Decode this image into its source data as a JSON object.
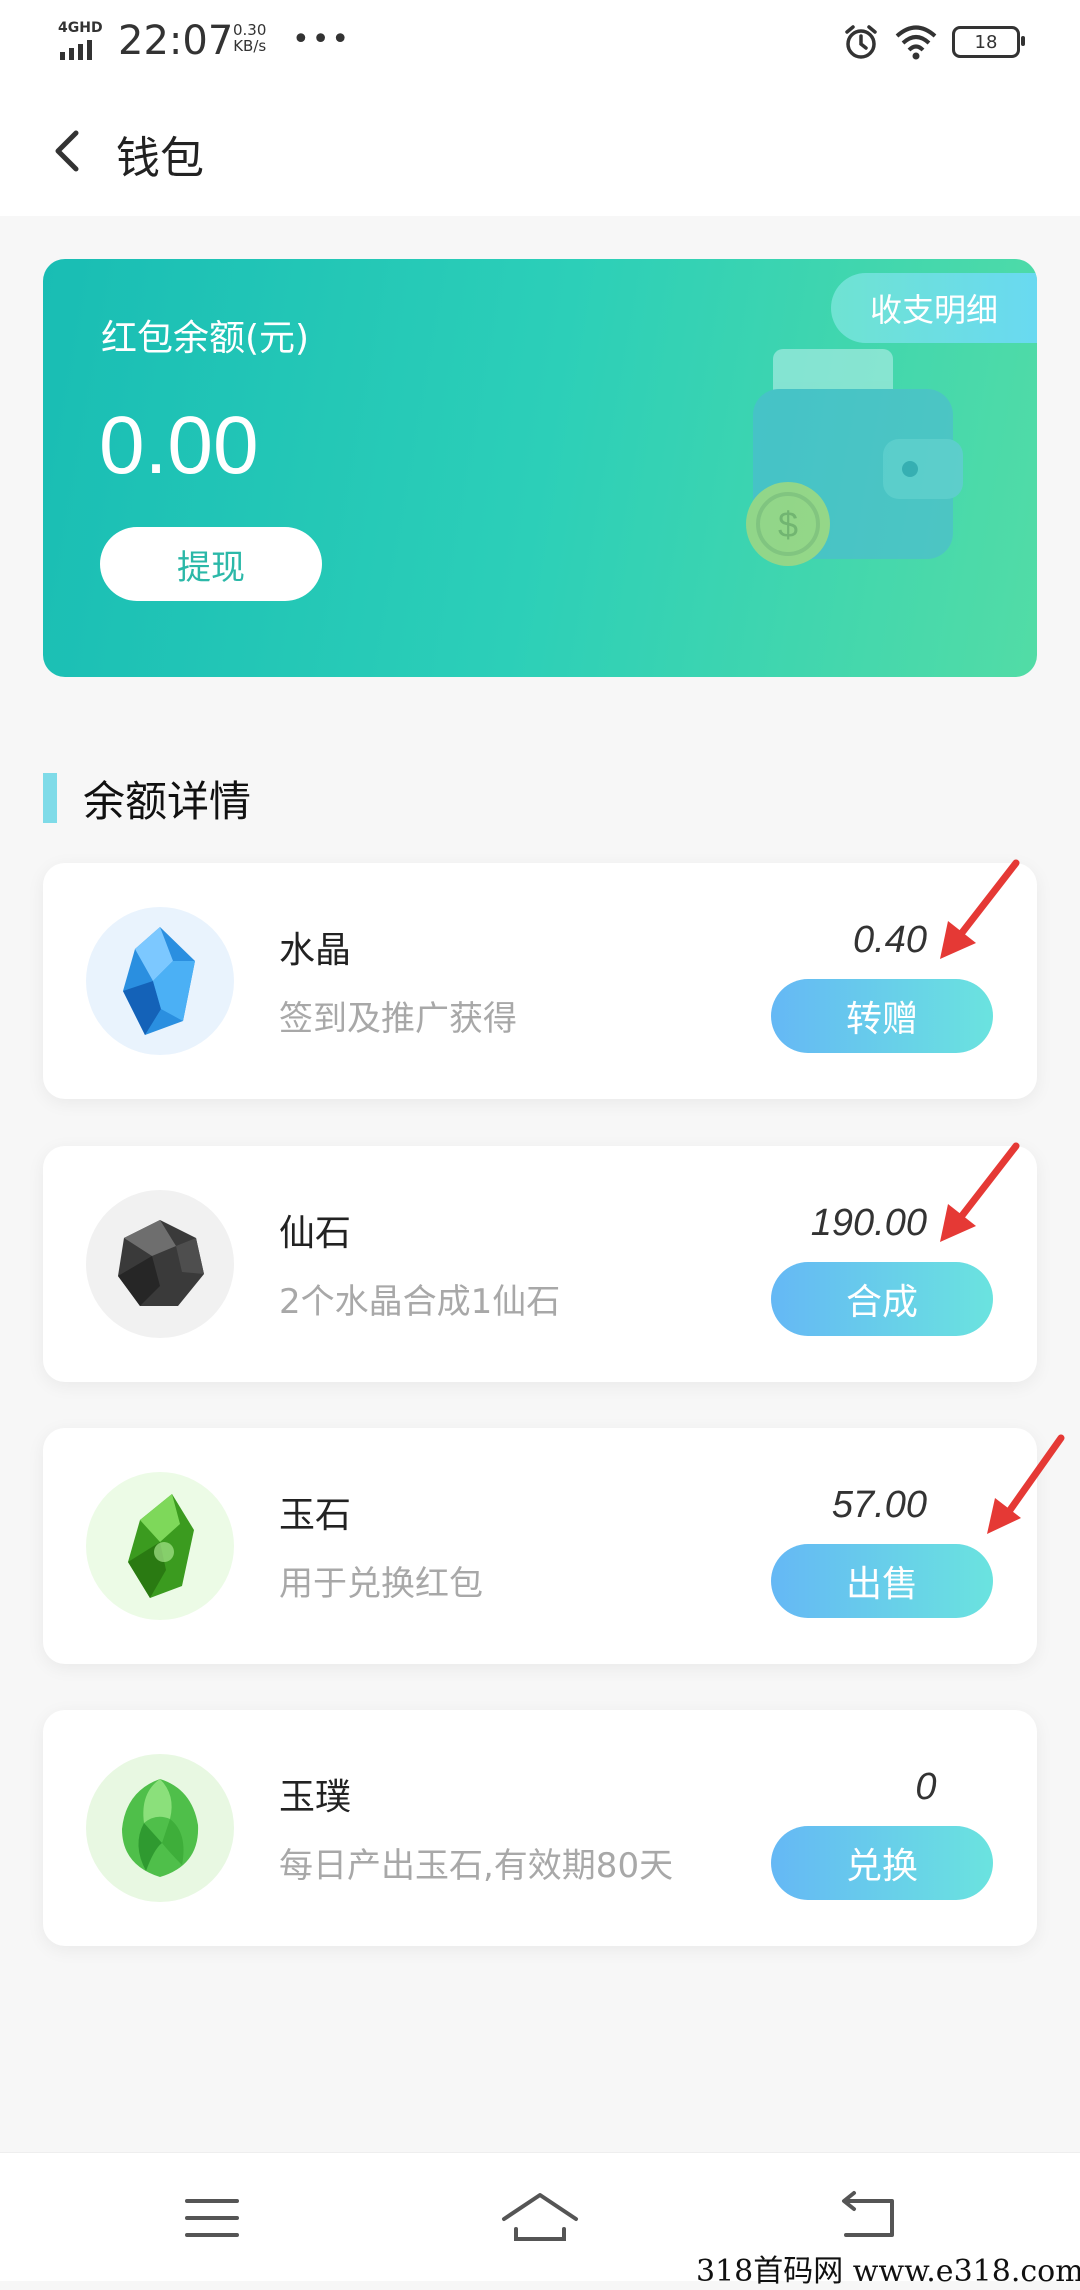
{
  "status_bar": {
    "network": "4GHD",
    "time": "22:07",
    "speed_value": "0.30",
    "speed_unit": "KB/s",
    "more": "•••",
    "battery": "18"
  },
  "header": {
    "title": "钱包"
  },
  "balance_card": {
    "label": "红包余额(元)",
    "value": "0.00",
    "withdraw_label": "提现",
    "detail_label": "收支明细"
  },
  "section": {
    "title": "余额详情"
  },
  "items": [
    {
      "name": "水晶",
      "desc": "签到及推广获得",
      "value": "0.40",
      "action": "转赠"
    },
    {
      "name": "仙石",
      "desc": "2个水晶合成1仙石",
      "value": "190.00",
      "action": "合成"
    },
    {
      "name": "玉石",
      "desc": "用于兑换红包",
      "value": "57.00",
      "action": "出售"
    },
    {
      "name": "玉璞",
      "desc": "每日产出玉石,有效期80天",
      "value": "0",
      "action": "兑换"
    }
  ],
  "watermark": "318首码网   www.e318.com",
  "colors": {
    "card_gradient_start": "#19bdb4",
    "card_gradient_end": "#52dca6",
    "button_gradient_start": "#65b8f5",
    "button_gradient_end": "#6ae3df",
    "annotation_arrow": "#e53935"
  }
}
